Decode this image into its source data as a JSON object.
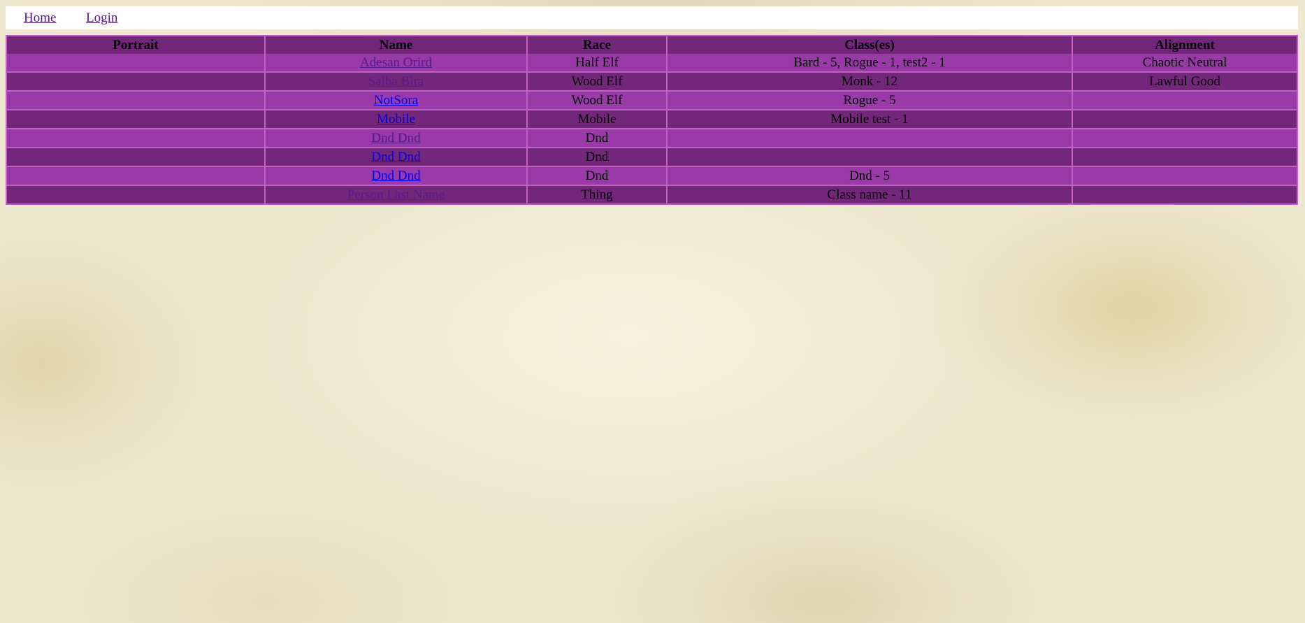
{
  "nav": {
    "home_label": "Home",
    "login_label": "Login"
  },
  "table": {
    "headers": {
      "portrait": "Portrait",
      "name": "Name",
      "race": "Race",
      "classes": "Class(es)",
      "alignment": "Alignment"
    },
    "rows": [
      {
        "name": "Adesan Orird",
        "race": "Half Elf",
        "classes": "Bard - 5, Rogue - 1, test2 - 1",
        "alignment": "Chaotic Neutral",
        "visited": true
      },
      {
        "name": "Saiba Bira",
        "race": "Wood Elf",
        "classes": "Monk - 12",
        "alignment": "Lawful Good",
        "visited": true
      },
      {
        "name": "NotSora",
        "race": "Wood Elf",
        "classes": "Rogue - 5",
        "alignment": "",
        "visited": false
      },
      {
        "name": "Mobile",
        "race": "Mobile",
        "classes": "Mobile test - 1",
        "alignment": "",
        "visited": false
      },
      {
        "name": "Dnd Dnd",
        "race": "Dnd",
        "classes": "",
        "alignment": "",
        "visited": true
      },
      {
        "name": "Dnd Dnd",
        "race": "Dnd",
        "classes": "",
        "alignment": "",
        "visited": false
      },
      {
        "name": "Dnd Dnd",
        "race": "Dnd",
        "classes": "Dnd - 5",
        "alignment": "",
        "visited": false
      },
      {
        "name": "Person Last Name",
        "race": "Thing",
        "classes": "Class name - 11",
        "alignment": "",
        "visited": true
      }
    ]
  },
  "colors": {
    "header_bg": "#72277a",
    "row_light": "#993aa8",
    "row_dark": "#72277a",
    "border": "#c25fc6",
    "link_visited": "#551a8b",
    "link_unvisited": "#0000ee",
    "parchment": "#efe8d1"
  }
}
